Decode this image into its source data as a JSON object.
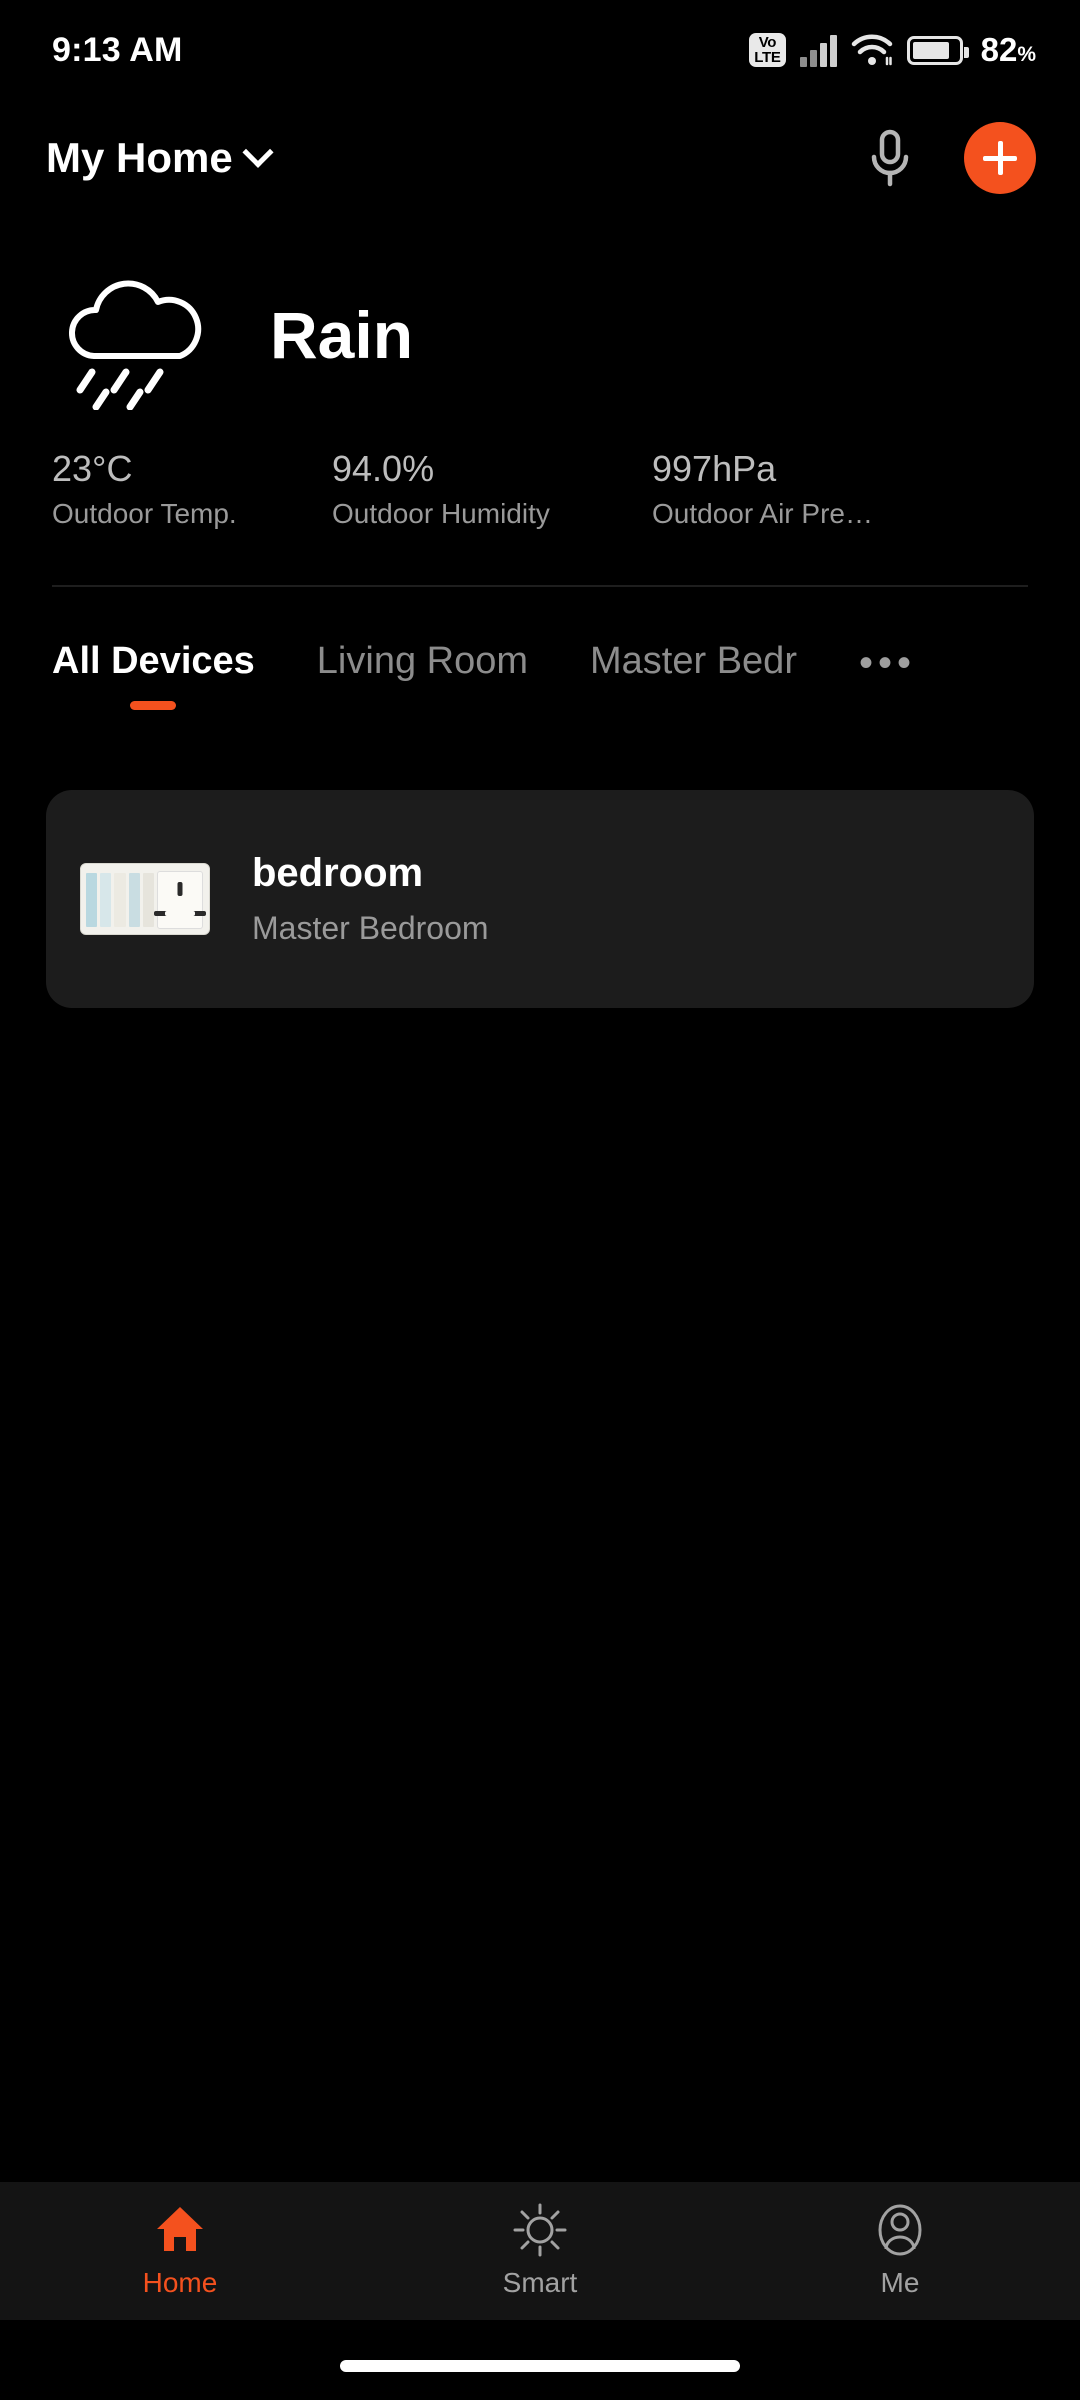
{
  "status_bar": {
    "time": "9:13 AM",
    "network_badge": {
      "line1": "Vo",
      "line2": "LTE"
    },
    "signal_icon": "cellular-signal-icon",
    "wifi_icon": "wifi-icon",
    "battery_icon": "battery-icon",
    "battery_percent": "82",
    "battery_unit": "%"
  },
  "header": {
    "home_name": "My Home",
    "chevron_icon": "chevron-down-icon",
    "mic_icon": "microphone-icon",
    "add_icon": "plus-icon"
  },
  "weather": {
    "icon": "rain-cloud-icon",
    "condition": "Rain",
    "stats": [
      {
        "value": "23°C",
        "label": "Outdoor Temp."
      },
      {
        "value": "94.0%",
        "label": "Outdoor Humidity"
      },
      {
        "value": "997hPa",
        "label": "Outdoor Air Pre…"
      }
    ]
  },
  "tabs": {
    "items": [
      {
        "label": "All Devices",
        "active": true
      },
      {
        "label": "Living Room",
        "active": false
      },
      {
        "label": "Master Bedr",
        "active": false
      }
    ],
    "more_label": "•••",
    "active_indicator_color": "#f4511e"
  },
  "devices": [
    {
      "name": "bedroom",
      "room": "Master Bedroom",
      "thumbnail_icon": "wall-switch-socket-icon"
    }
  ],
  "bottom_nav": {
    "items": [
      {
        "label": "Home",
        "icon": "home-icon",
        "active": true
      },
      {
        "label": "Smart",
        "icon": "sun-icon",
        "active": false
      },
      {
        "label": "Me",
        "icon": "person-icon",
        "active": false
      }
    ],
    "active_color": "#f4511e",
    "inactive_color": "#a2a2a2"
  }
}
